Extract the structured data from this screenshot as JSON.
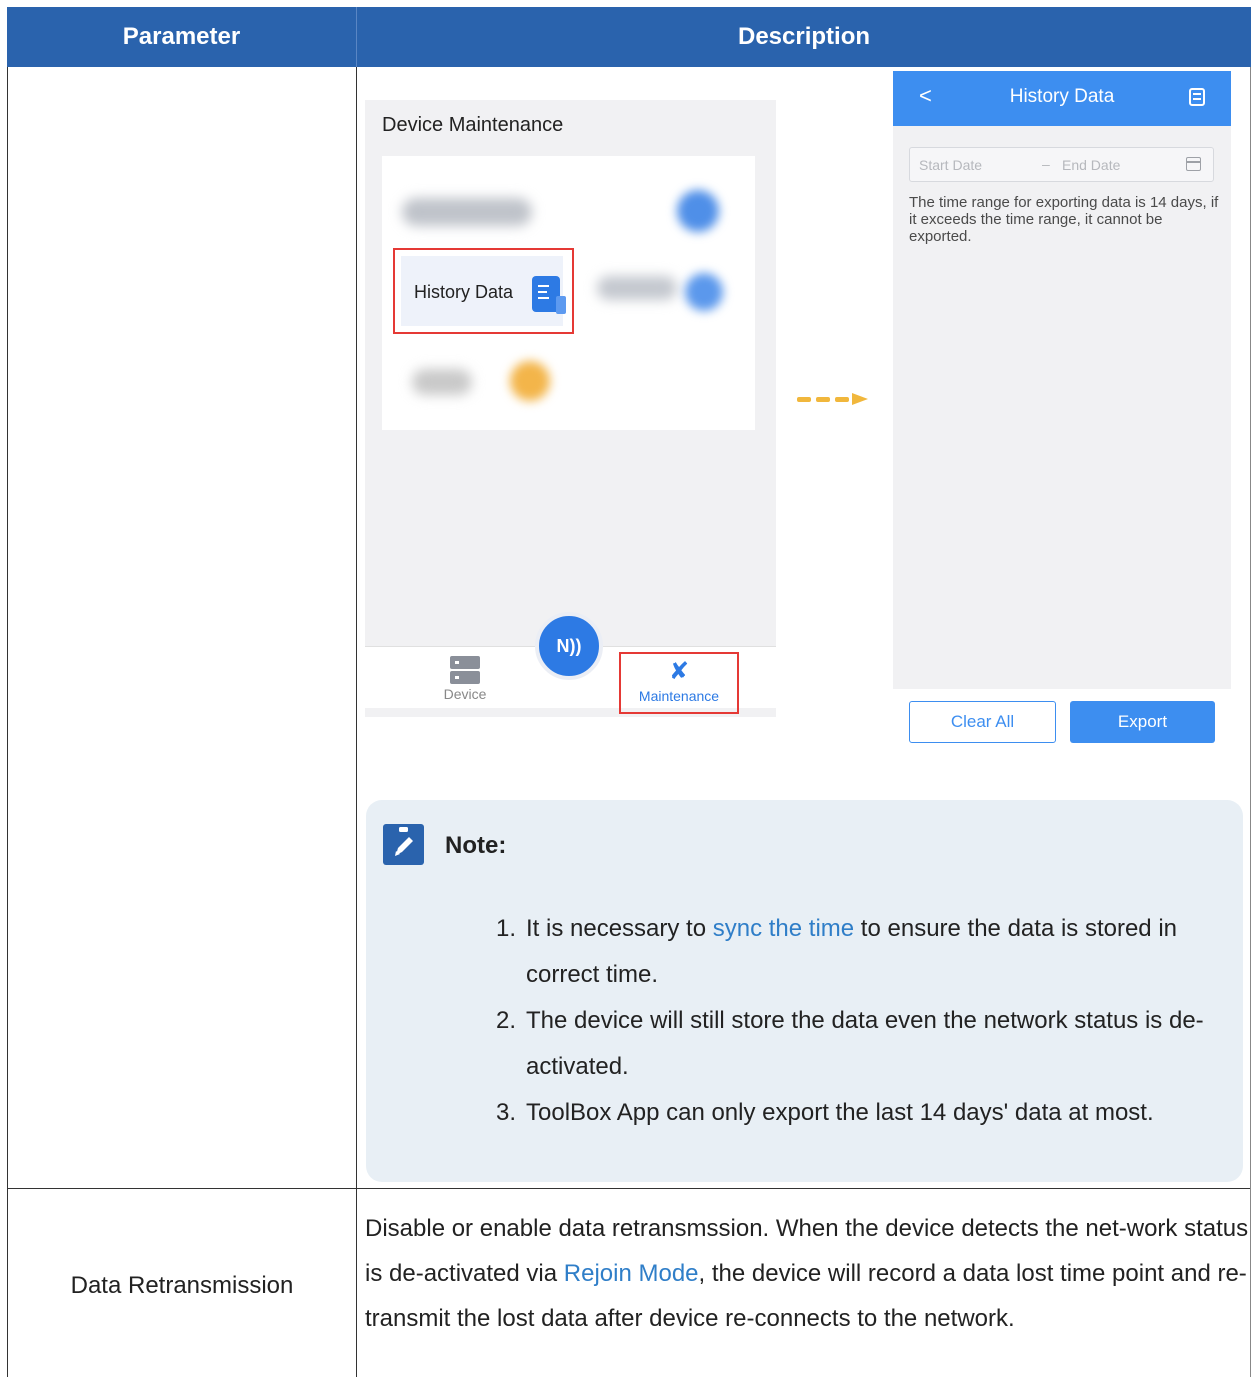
{
  "table": {
    "header": {
      "parameter": "Parameter",
      "description": "Description"
    }
  },
  "left_phone": {
    "title": "Device Maintenance",
    "history_item": "History Data",
    "nav_device": "Device",
    "nav_maintenance": "Maintenance",
    "nfc_symbol": "N))"
  },
  "right_phone": {
    "back_symbol": "<",
    "title": "History Data",
    "start_placeholder": "Start Date",
    "separator": "–",
    "end_placeholder": "End Date",
    "info": "The time range for exporting data is 14 days, if it exceeds the time range, it cannot be exported.",
    "clear_label": "Clear All",
    "export_label": "Export"
  },
  "note": {
    "title": "Note:",
    "item1": {
      "num": "1.",
      "before": "It is necessary to ",
      "link": "sync the time",
      "after": " to ensure the data is stored in correct time."
    },
    "item2": {
      "num": "2.",
      "text": "The device will still store the data even the network status is de-activated."
    },
    "item3": {
      "num": "3.",
      "text": "ToolBox App can only export the last 14 days' data at most."
    }
  },
  "row2": {
    "parameter": "Data Retransmission",
    "desc_before": "Disable or enable data retransmssion. When the device detects the net-work status is de-activated via ",
    "desc_link": "Rejoin Mode",
    "desc_after": ", the device will record a data lost time point and re-transmit the lost data after device re-connects to the network."
  },
  "colors": {
    "header_bg": "#2a63ad",
    "app_blue": "#3d8ef0",
    "highlight_red": "#e53935",
    "link": "#2f7ec8",
    "note_bg": "#e8eff5"
  }
}
